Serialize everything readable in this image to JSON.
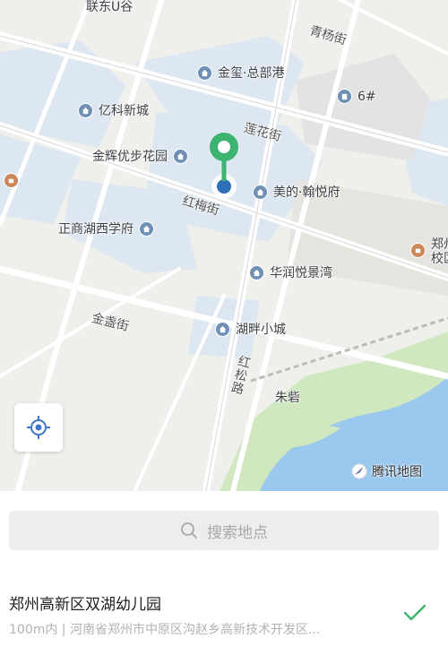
{
  "map": {
    "labels": {
      "liandong": "联东U谷",
      "qingyang": "青杨街",
      "jinxi": "金玺·总部港",
      "six": "6#",
      "yike": "亿科新城",
      "lianhua": "莲花街",
      "jinhui": "金辉优步花园",
      "meide": "美的·翰悦府",
      "hongmei": "红梅街",
      "zhengshang": "正商湖西学府",
      "zhengzhou_school": "郑州\n校区",
      "huarun": "华润悦景湾",
      "jinzhan": "金盏街",
      "hupan": "湖畔小城",
      "hongsong": "红松路",
      "zhuzhai": "朱砦"
    },
    "brand": "腾讯地图",
    "colors": {
      "land": "#efefec",
      "block": "#dde7f2",
      "road": "#ffffff",
      "water": "#9bc8ee",
      "park": "#cfe8c0",
      "pin": "#3cb371",
      "dot": "#2f6fb8"
    }
  },
  "search": {
    "placeholder": "搜索地点"
  },
  "result": {
    "name": "郑州高新区双湖幼儿园",
    "description": "100m内 | 河南省郑州市中原区沟赵乡高新技术开发区..."
  },
  "icons": {
    "locate": "locate-crosshair-icon",
    "search": "search-icon",
    "check": "checkmark-icon",
    "poi": "house-icon",
    "pin": "map-pin-icon"
  }
}
